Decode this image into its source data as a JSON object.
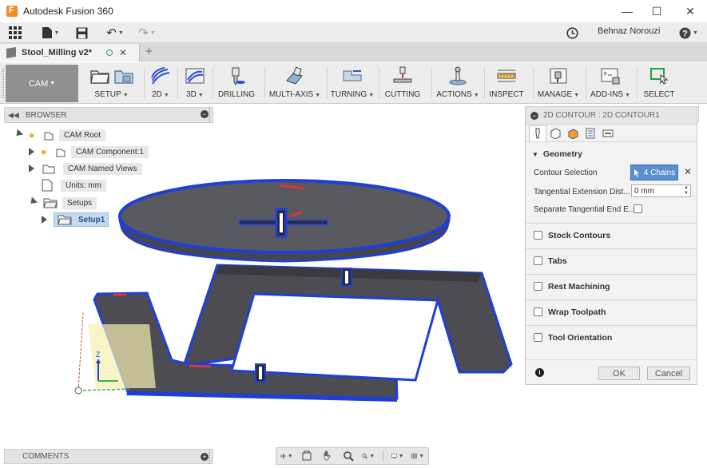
{
  "window": {
    "title": "Autodesk Fusion 360"
  },
  "quick_access": {
    "user": "Behnaz Norouzi"
  },
  "document_tab": {
    "name": "Stool_Milling v2*"
  },
  "toolbar": {
    "workspace": "CAM",
    "groups": [
      {
        "label": "SETUP",
        "has_menu": true
      },
      {
        "label": "2D",
        "has_menu": true
      },
      {
        "label": "3D",
        "has_menu": true
      },
      {
        "label": "DRILLING",
        "has_menu": false
      },
      {
        "label": "MULTI-AXIS",
        "has_menu": true
      },
      {
        "label": "TURNING",
        "has_menu": true
      },
      {
        "label": "CUTTING",
        "has_menu": false
      },
      {
        "label": "ACTIONS",
        "has_menu": true
      },
      {
        "label": "INSPECT",
        "has_menu": false
      },
      {
        "label": "MANAGE",
        "has_menu": true
      },
      {
        "label": "ADD-INS",
        "has_menu": true
      },
      {
        "label": "SELECT",
        "has_menu": false
      }
    ]
  },
  "browser": {
    "title": "BROWSER",
    "items": [
      {
        "label": "CAM Root"
      },
      {
        "label": "CAM Component:1"
      },
      {
        "label": "CAM Named Views"
      },
      {
        "label": "Units: mm"
      },
      {
        "label": "Setups"
      },
      {
        "label": "Setup1"
      }
    ]
  },
  "viewcube": {
    "axis_label": "Z"
  },
  "panel": {
    "title": "2D CONTOUR : 2D CONTOUR1",
    "geometry_heading": "Geometry",
    "contour_selection_label": "Contour Selection",
    "contour_selection_value": "4 Chains",
    "tangential_extension_label": "Tangential Extension Dist...",
    "tangential_extension_value": "0 mm",
    "separate_tangential_label": "Separate Tangential End E...",
    "sections": [
      "Stock Contours",
      "Tabs",
      "Rest Machining",
      "Wrap Toolpath",
      "Tool Orientation"
    ],
    "ok_label": "OK",
    "cancel_label": "Cancel"
  },
  "comments": {
    "title": "COMMENTS"
  },
  "colors": {
    "accent_blue": "#1f3fd9",
    "selection_blue": "#5a8fcf",
    "body_gray": "#4a4a4f",
    "workspace_gray": "#8f8f8f"
  }
}
